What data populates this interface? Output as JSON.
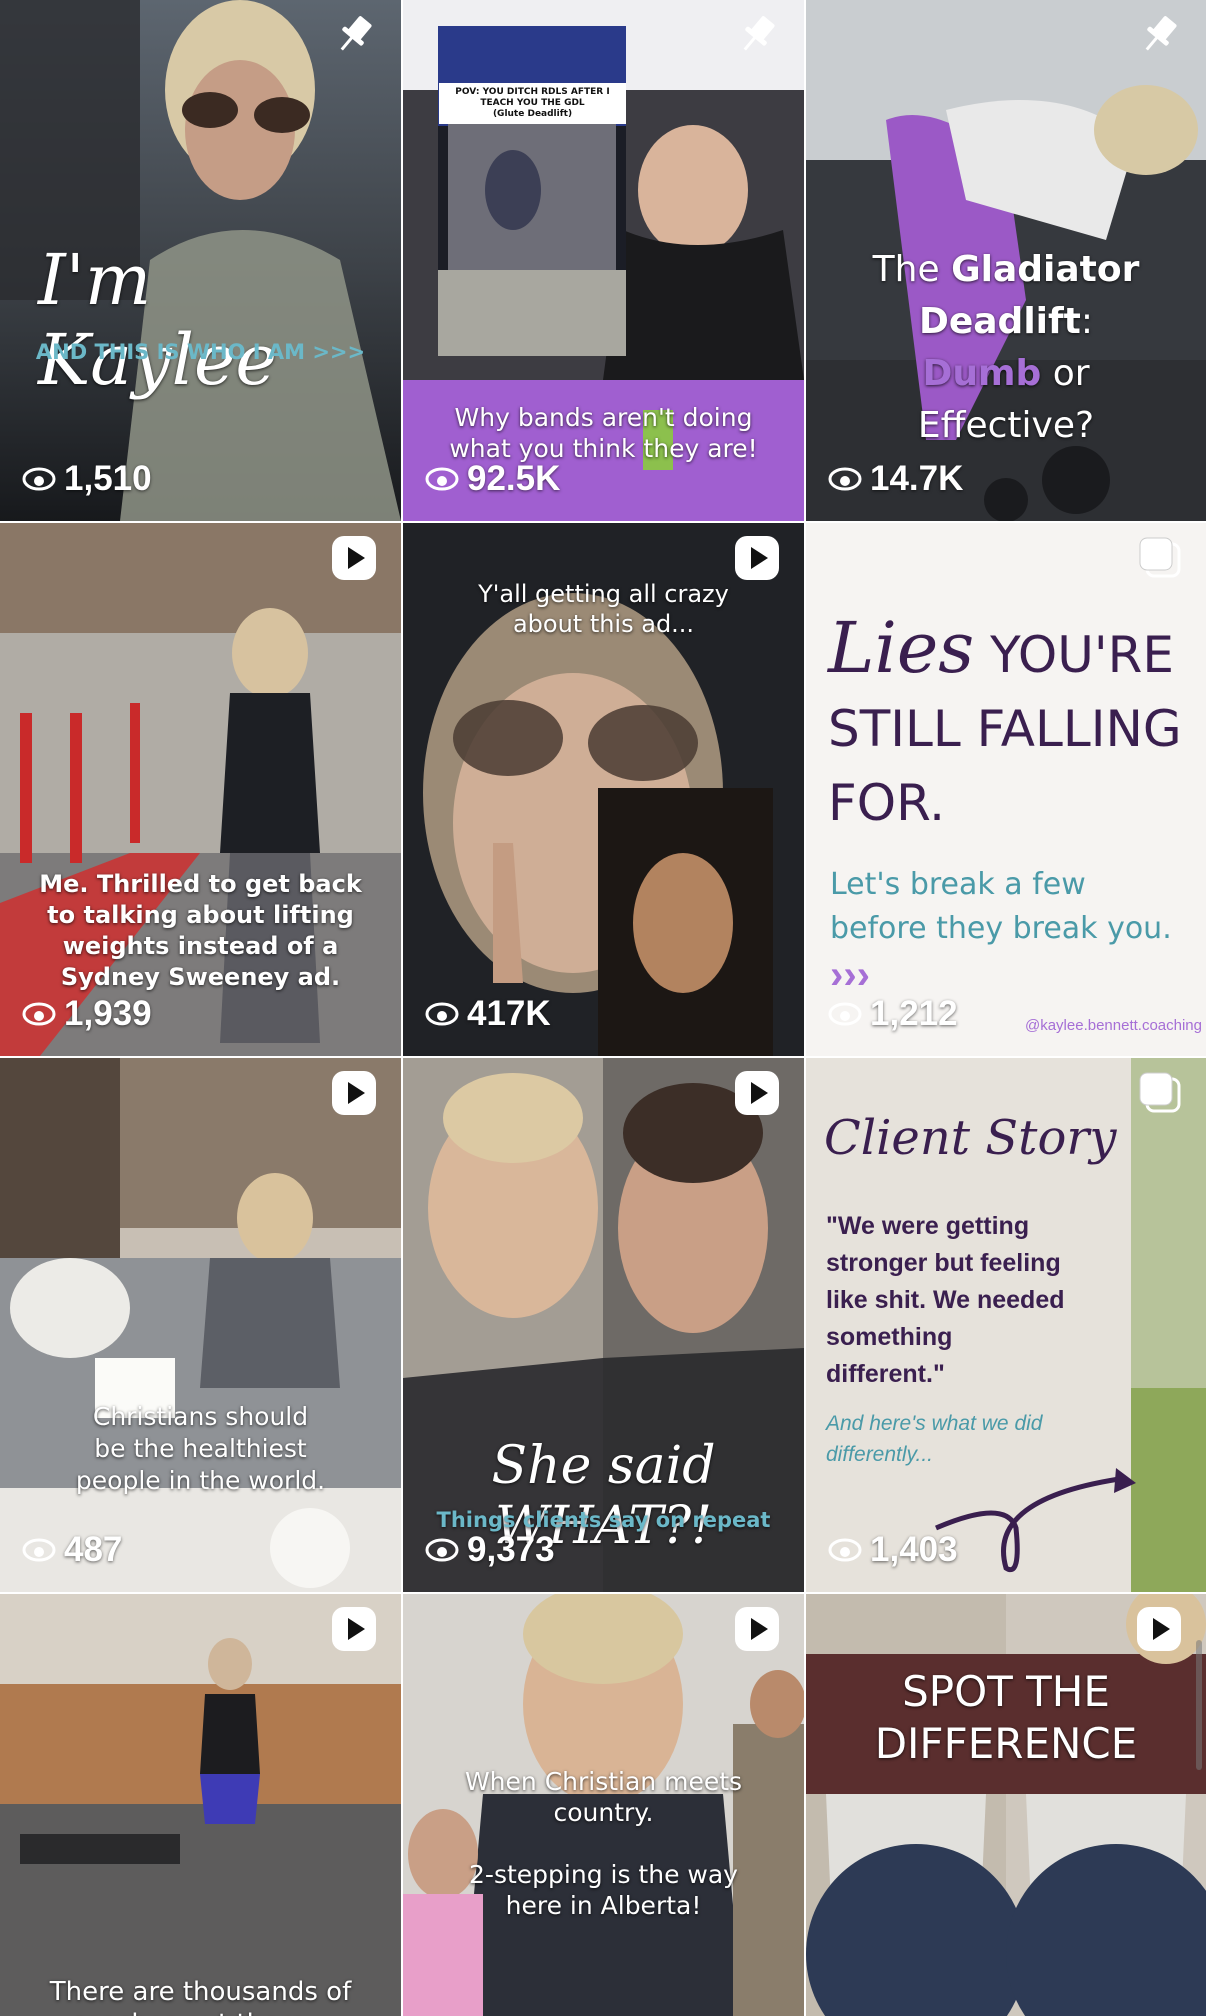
{
  "tiles": [
    {
      "views": "1,510",
      "icon": "pin-icon",
      "title_script": "I'm Kaylee",
      "subtitle": "AND THIS IS WHO I AM >>>",
      "accent": "#6bb8c8"
    },
    {
      "views": "92.5K",
      "icon": "pin-icon",
      "inset_text": "POV: YOU DITCH RDLS AFTER I TEACH YOU THE GDL\n(Glute Deadlift)",
      "caption": "Why bands aren't doing\nwhat you think they are!"
    },
    {
      "views": "14.7K",
      "icon": "pin-icon",
      "title_pre": "The ",
      "title_bold": "Gladiator\nDeadlift",
      "title_colon": ":",
      "title_purple": "Dumb",
      "title_post": " or\nEffective?",
      "purple": "#a66fd6"
    },
    {
      "views": "1,939",
      "icon": "play-icon",
      "caption": "Me. Thrilled to get back\nto talking about lifting\nweights instead of a\nSydney Sweeney ad."
    },
    {
      "views": "417K",
      "icon": "play-icon",
      "caption": "Y'all getting all crazy\nabout this ad..."
    },
    {
      "views": "1,212",
      "icon": "carousel-icon",
      "lies_script": "Lies",
      "lies_rest": " YOU'RE\nSTILL FALLING\nFOR.",
      "teal_text": "Let's break a few\nbefore they break you.",
      "arrows": "›››",
      "handle": "@kaylee.bennett.coaching",
      "ink": "#3a1f4f",
      "teal": "#4a9aa8"
    },
    {
      "views": "487",
      "icon": "play-icon",
      "caption": "Christians should\nbe the healthiest\npeople in the world."
    },
    {
      "views": "9,373",
      "icon": "play-icon",
      "title_script": "She said WHAT?!",
      "subtitle": "Things clients say on repeat"
    },
    {
      "views": "1,403",
      "icon": "carousel-icon",
      "title_script": "Client Story",
      "quote": "\"We were getting\nstronger but feeling\nlike shit. We needed\nsomething\ndifferent.\"",
      "teal_text": "And here's what we did\ndifferently..."
    },
    {
      "views": "",
      "icon": "play-icon",
      "caption": "There are thousands of\ncoaches out there..."
    },
    {
      "views": "",
      "icon": "play-icon",
      "caption": "When Christian meets\ncountry.\n\n2-stepping is the way\nhere in Alberta!"
    },
    {
      "views": "",
      "icon": "play-icon",
      "title": "SPOT THE\nDIFFERENCE"
    }
  ]
}
